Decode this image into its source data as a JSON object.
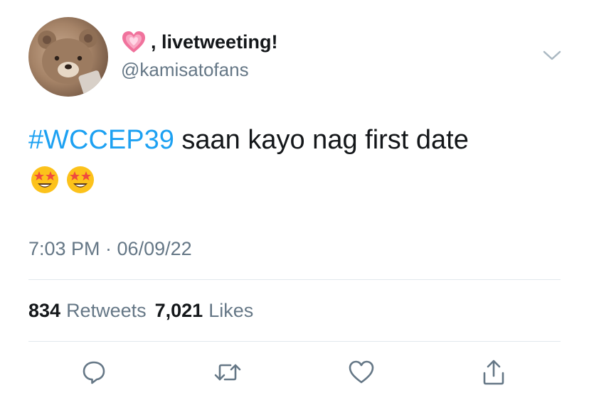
{
  "user": {
    "display_name": ", livetweeting!",
    "name_emoji": "growing-heart-emoji",
    "handle": "@kamisatofans",
    "avatar_icon": "teddy-bear-avatar"
  },
  "tweet": {
    "hashtag": "#WCCEP39",
    "text": " saan kayo nag first date",
    "emojis": [
      "star-struck-emoji",
      "star-struck-emoji"
    ]
  },
  "timestamp": "7:03 PM · 06/09/22",
  "stats": {
    "retweets_count": "834",
    "retweets_label": "Retweets",
    "likes_count": "7,021",
    "likes_label": "Likes"
  },
  "actions": {
    "reply_icon": "reply-icon",
    "retweet_icon": "retweet-icon",
    "like_icon": "heart-icon",
    "share_icon": "share-icon"
  },
  "colors": {
    "hashtag": "#1da1f2",
    "secondary_text": "#657786",
    "divider": "#e1e8ed",
    "icon": "#657786"
  }
}
